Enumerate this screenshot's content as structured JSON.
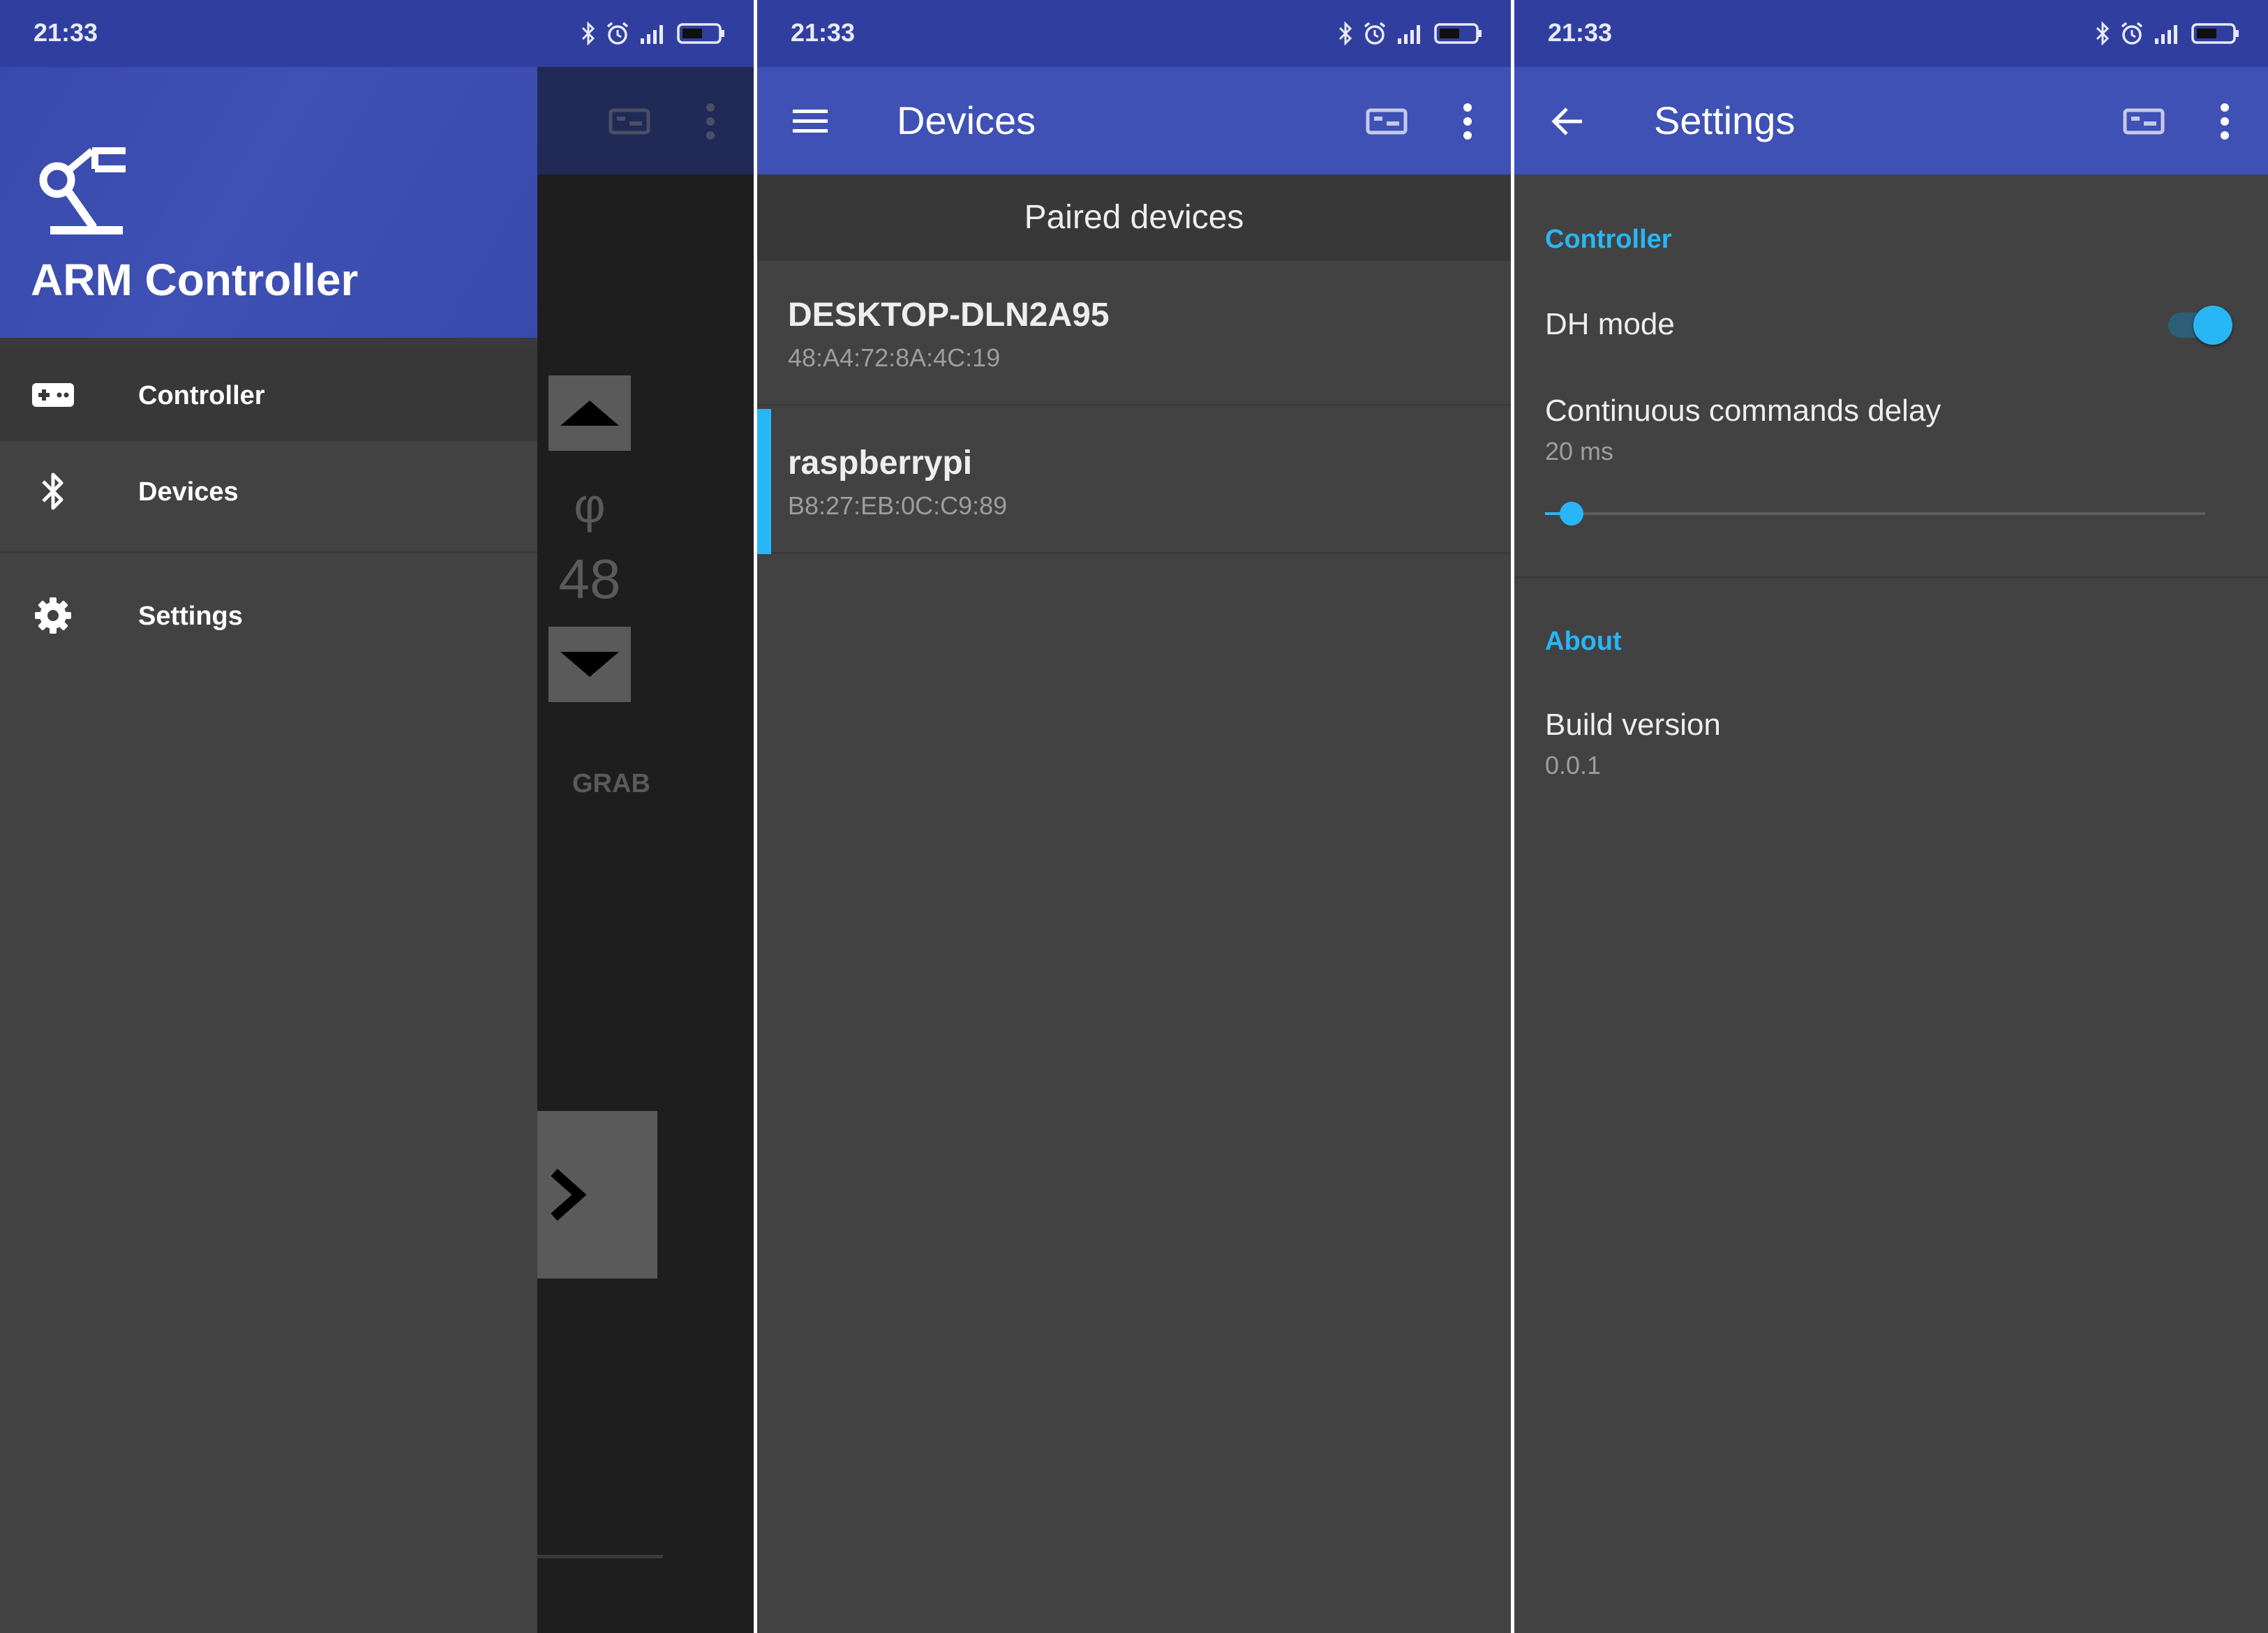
{
  "colors": {
    "primary": "#3f51b5",
    "primary_dark": "#303f9f",
    "accent": "#29b6f6",
    "background": "#424242"
  },
  "status_bar": {
    "time": "21:33",
    "icons": [
      "bluetooth-icon",
      "alarm-icon",
      "signal-icon",
      "battery-icon"
    ]
  },
  "screen_controller": {
    "drawer": {
      "app_title": "ARM Controller",
      "logo_icon": "robot-arm-icon",
      "items": [
        {
          "label": "Controller",
          "icon": "gamepad-icon",
          "selected": true
        },
        {
          "label": "Devices",
          "icon": "bluetooth-icon",
          "selected": false
        },
        {
          "label": "Settings",
          "icon": "gear-icon",
          "selected": false
        }
      ]
    },
    "behind": {
      "phi_symbol": "φ",
      "phi_value": "48",
      "grab_label": "GRAB"
    }
  },
  "screen_devices": {
    "title": "Devices",
    "section_header": "Paired devices",
    "devices": [
      {
        "name": "DESKTOP-DLN2A95",
        "mac": "48:A4:72:8A:4C:19",
        "selected": false
      },
      {
        "name": "raspberrypi",
        "mac": "B8:27:EB:0C:C9:89",
        "selected": true
      }
    ]
  },
  "screen_settings": {
    "title": "Settings",
    "categories": {
      "controller": "Controller",
      "about": "About"
    },
    "dh_mode": {
      "title": "DH mode",
      "enabled": true
    },
    "delay": {
      "title": "Continuous commands delay",
      "summary": "20 ms",
      "slider_fraction": 0.04
    },
    "build": {
      "title": "Build version",
      "summary": "0.0.1"
    }
  }
}
